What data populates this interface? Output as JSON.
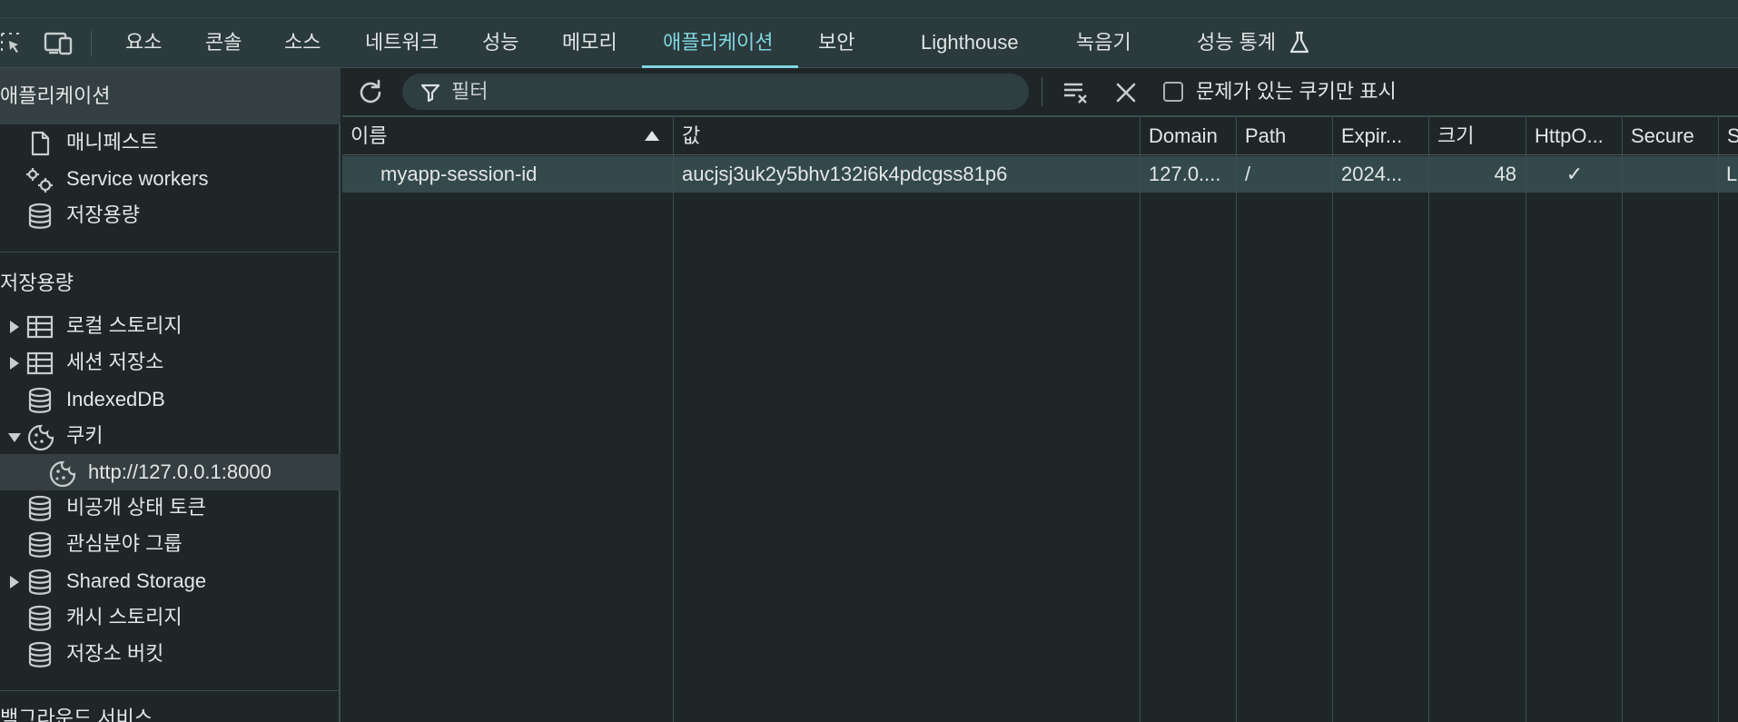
{
  "tabs": [
    {
      "label": "요소"
    },
    {
      "label": "콘솔"
    },
    {
      "label": "소스"
    },
    {
      "label": "네트워크"
    },
    {
      "label": "성능"
    },
    {
      "label": "메모리"
    },
    {
      "label": "애플리케이션"
    },
    {
      "label": "보안"
    },
    {
      "label": "Lighthouse"
    },
    {
      "label": "녹음기"
    },
    {
      "label": "성능 통계"
    }
  ],
  "active_tab": "애플리케이션",
  "colors": {
    "accent": "#7fd6e0",
    "row_selected": "#34494c",
    "panel": "#2b3a3c"
  },
  "sidebar": {
    "app_section": "애플리케이션",
    "app_items": [
      {
        "label": "매니페스트",
        "icon": "file-icon"
      },
      {
        "label": "Service workers",
        "icon": "gears-icon"
      },
      {
        "label": "저장용량",
        "icon": "database-icon"
      }
    ],
    "storage_section": "저장용량",
    "storage_items": [
      {
        "label": "로컬 스토리지",
        "icon": "table-icon"
      },
      {
        "label": "세션 저장소",
        "icon": "table-icon"
      },
      {
        "label": "IndexedDB",
        "icon": "database-icon"
      },
      {
        "label": "쿠키",
        "icon": "cookie-icon"
      },
      {
        "label": "http://127.0.0.1:8000",
        "icon": "cookie-icon"
      },
      {
        "label": "비공개 상태 토큰",
        "icon": "database-icon"
      },
      {
        "label": "관심분야 그룹",
        "icon": "database-icon"
      },
      {
        "label": "Shared Storage",
        "icon": "database-icon"
      },
      {
        "label": "캐시 스토리지",
        "icon": "database-icon"
      },
      {
        "label": "저장소 버킷",
        "icon": "database-icon"
      }
    ],
    "background_section": "백그라운드 서비스"
  },
  "toolbar": {
    "filter_placeholder": "필터",
    "only_issues_label": "문제가 있는 쿠키만 표시"
  },
  "table": {
    "columns": [
      "이름",
      "값",
      "Domain",
      "Path",
      "Expir...",
      "크기",
      "HttpO...",
      "Secure",
      "S"
    ],
    "rows": [
      {
        "name": "myapp-session-id",
        "value": "aucjsj3uk2y5bhv132i6k4pdcgss81p6",
        "domain": "127.0....",
        "path": "/",
        "expires": "2024...",
        "size": "48",
        "httponly": "✓",
        "secure": "",
        "samesite": "L"
      }
    ]
  }
}
